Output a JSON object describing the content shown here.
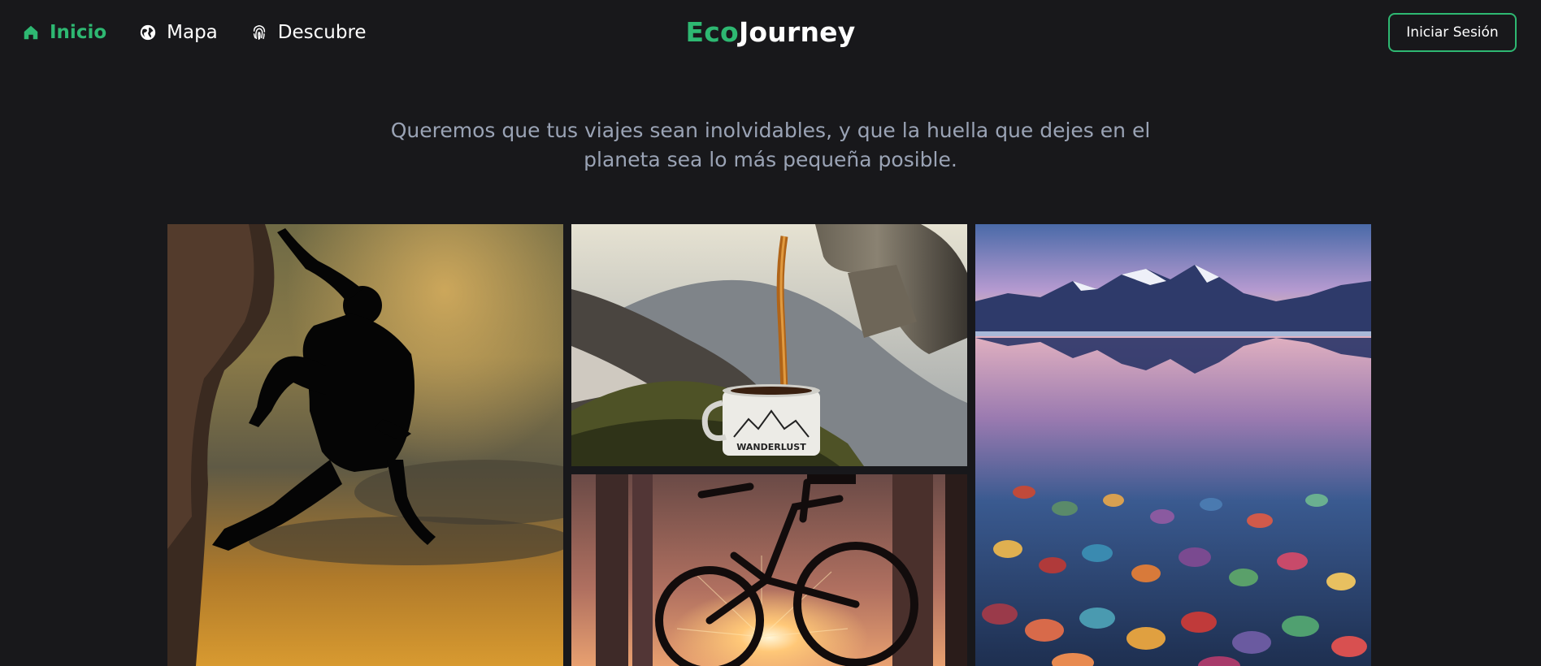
{
  "navbar": {
    "links": [
      {
        "label": "Inicio",
        "icon": "home-icon",
        "active": true
      },
      {
        "label": "Mapa",
        "icon": "globe-icon",
        "active": false
      },
      {
        "label": "Descubre",
        "icon": "fingerprint-icon",
        "active": false
      }
    ],
    "logo": {
      "part1": "Eco",
      "part2": "Journey"
    },
    "login_label": "Iniciar Sesión"
  },
  "tagline": {
    "line1": "Queremos que tus viajes sean inolvidables, y que la huella que dejes en el",
    "line2": "planeta sea lo más pequeña posible."
  },
  "gallery": [
    {
      "name": "climber-photo",
      "subject": "rock climber silhouette at sunset"
    },
    {
      "name": "coffee-photo",
      "subject": "coffee pouring into camping mug in mountains",
      "mug_text": "WANDERLUST"
    },
    {
      "name": "bike-photo",
      "subject": "bicycle silhouette with sunburst in forest"
    },
    {
      "name": "lake-photo",
      "subject": "mountain lake with colorful pebbles"
    }
  ],
  "colors": {
    "background": "#18181b",
    "accent": "#2eb872",
    "tagline": "#9aa3b5",
    "text": "#ffffff"
  }
}
